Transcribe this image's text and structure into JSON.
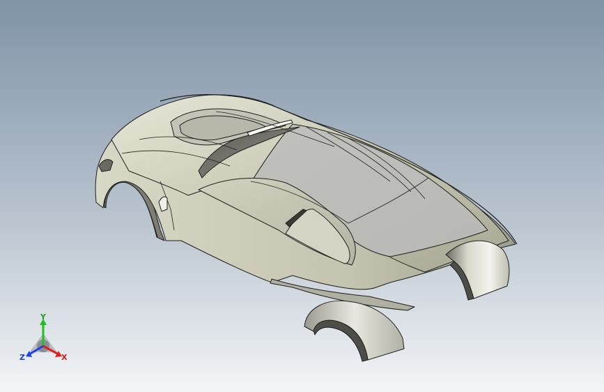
{
  "viewport": {
    "background_top": "#7f93a7",
    "background_bottom": "#f2f4f7",
    "body_color": "#c9c9b4",
    "body_shadow": "#8f8f7e",
    "edge_color": "#1e1e1e"
  },
  "triad": {
    "x_label": "X",
    "y_label": "Y",
    "z_label": "Z",
    "x_color": "#e02020",
    "y_color": "#20c020",
    "z_color": "#2040e0"
  }
}
